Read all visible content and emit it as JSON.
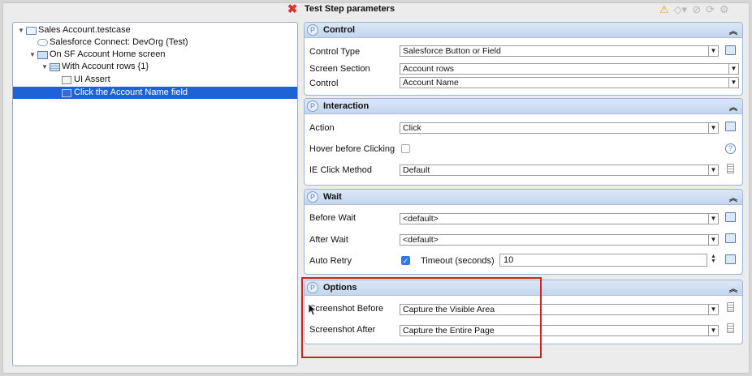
{
  "tree": {
    "items": [
      {
        "label": "Sales Account.testcase",
        "icon": "testcase-icon",
        "expanded": true,
        "selected": false
      },
      {
        "label": "Salesforce Connect: DevOrg (Test)",
        "icon": "cloud-icon",
        "expanded": false,
        "selected": false
      },
      {
        "label": "On SF Account Home screen",
        "icon": "screen-icon",
        "expanded": true,
        "selected": false
      },
      {
        "label": "With Account rows {1}",
        "icon": "table-icon",
        "expanded": true,
        "selected": false
      },
      {
        "label": "UI Assert",
        "icon": "assert-icon",
        "expanded": false,
        "selected": false
      },
      {
        "label": "Click the Account Name field",
        "icon": "click-icon",
        "expanded": false,
        "selected": true
      }
    ]
  },
  "params": {
    "title": "Test Step parameters",
    "control": {
      "title": "Control",
      "control_type_label": "Control Type",
      "control_type_value": "Salesforce Button or Field",
      "screen_section_label": "Screen Section",
      "screen_section_value": "Account rows",
      "control_label": "Control",
      "control_value": "Account Name"
    },
    "interaction": {
      "title": "Interaction",
      "action_label": "Action",
      "action_value": "Click",
      "hover_label": "Hover before Clicking",
      "hover_checked": false,
      "ie_label": "IE Click Method",
      "ie_value": "Default"
    },
    "wait": {
      "title": "Wait",
      "before_label": "Before Wait",
      "before_value": "<default>",
      "after_label": "After Wait",
      "after_value": "<default>",
      "retry_label": "Auto Retry",
      "retry_checked": true,
      "timeout_label": "Timeout (seconds)",
      "timeout_value": "10"
    },
    "options": {
      "title": "Options",
      "shot_before_label": "Screenshot Before",
      "shot_before_value": "Capture the Visible Area",
      "shot_after_label": "Screenshot After",
      "shot_after_value": "Capture the Entire Page"
    }
  },
  "colors": {
    "accent": "#1f62d6",
    "highlight": "#c8242c",
    "section_header": "#c3d6ee"
  }
}
